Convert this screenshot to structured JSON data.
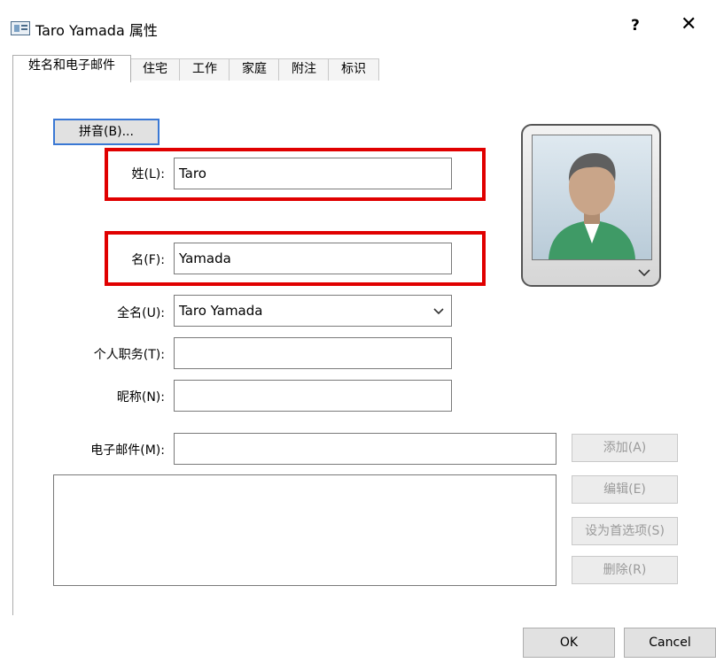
{
  "window": {
    "title": "Taro Yamada 属性",
    "help_label": "?",
    "close_label": "✕"
  },
  "tabs": [
    {
      "label": "姓名和电子邮件",
      "active": true
    },
    {
      "label": "住宅"
    },
    {
      "label": "工作"
    },
    {
      "label": "家庭"
    },
    {
      "label": "附注"
    },
    {
      "label": "标识"
    }
  ],
  "form": {
    "pinyin_button": "拼音(B)...",
    "last_name_label": "姓(L):",
    "last_name_value": "Taro",
    "first_name_label": "名(F):",
    "first_name_value": "Yamada",
    "full_name_label": "全名(U):",
    "full_name_value": "Taro Yamada",
    "title_label": "个人职务(T):",
    "title_value": "",
    "nickname_label": "昵称(N):",
    "nickname_value": "",
    "email_label": "电子邮件(M):",
    "email_value": ""
  },
  "email_buttons": {
    "add": "添加(A)",
    "edit": "编辑(E)",
    "set_default": "设为首选项(S)",
    "delete": "删除(R)"
  },
  "footer": {
    "ok": "OK",
    "cancel": "Cancel"
  },
  "colors": {
    "highlight": "#e00000",
    "focus": "#3a78d4"
  },
  "icons": {
    "window": "contact-card-icon",
    "dropdown": "chevron-down-icon",
    "photo": "user-avatar-icon"
  }
}
